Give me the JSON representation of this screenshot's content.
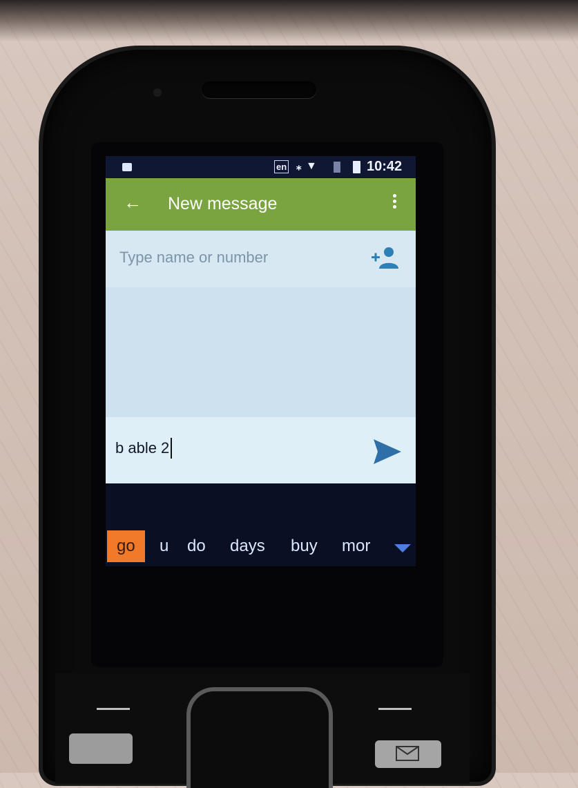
{
  "status_bar": {
    "language": "en",
    "time": "10:42",
    "icons": [
      "notification-icon",
      "bluetooth-icon",
      "wifi-icon",
      "signal-icon",
      "battery-icon"
    ]
  },
  "app_bar": {
    "back_icon": "arrow-left-icon",
    "title": "New message",
    "menu_icon": "more-vertical-icon",
    "color": "#7aa43f"
  },
  "recipient": {
    "placeholder": "Type name or number",
    "add_contact_icon": "add-contact-icon"
  },
  "compose": {
    "text": "b able 2",
    "send_icon": "send-icon"
  },
  "suggestions": {
    "items": [
      "go",
      "u",
      "do",
      "days",
      "buy",
      "mor"
    ],
    "selected": "go",
    "selected_color": "#f07a2a",
    "expand_icon": "triangle-down-icon"
  }
}
